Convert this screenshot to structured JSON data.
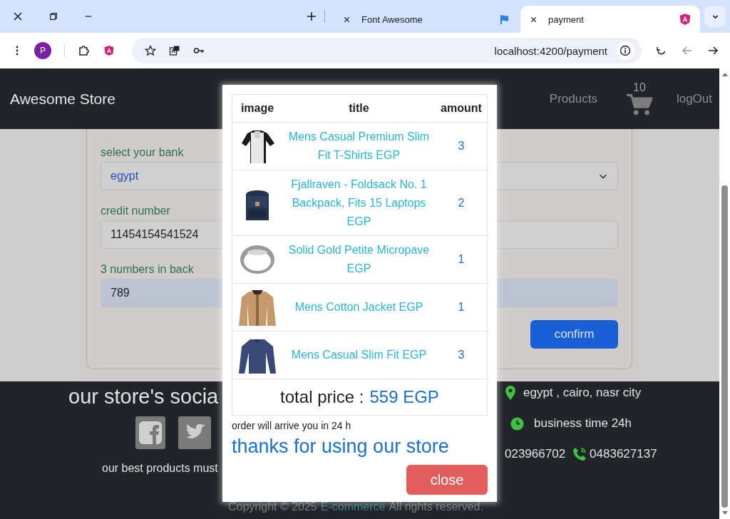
{
  "browser": {
    "tabs": [
      {
        "kind": "page",
        "title": "Font Awesome",
        "selected": false
      },
      {
        "kind": "flag",
        "selected": false
      },
      {
        "kind": "app",
        "title": "payment",
        "selected": true
      }
    ],
    "profile_initial": "P",
    "url": "localhost:4200/payment"
  },
  "navbar": {
    "brand": "Awesome Store",
    "links": [
      "Products"
    ],
    "cart_count": "10",
    "logout": "logOut"
  },
  "form": {
    "fields": [
      {
        "kind": "select",
        "label": "select your bank",
        "value": "egypt",
        "highlighted": false
      },
      {
        "kind": "text",
        "label": "credit number",
        "value": "11454154541524",
        "highlighted": false
      },
      {
        "kind": "text",
        "label": "3 numbers in back",
        "value": "789",
        "highlighted": true
      }
    ],
    "confirm": "confirm"
  },
  "footer": {
    "social_title": "our store's socia",
    "tagline": "our best products must",
    "contacts": [
      {
        "kind": "location",
        "text": "egypt , cairo, nasr city"
      },
      {
        "kind": "time",
        "text": "business time 24h"
      },
      {
        "kind": "phones",
        "text": "023966702",
        "text2": "0483627137"
      }
    ],
    "copyright": "Copyright © 2025",
    "copyright_link": "E-commerce",
    "copyright_tail": "All rights reserved."
  },
  "modal": {
    "columns": [
      "image",
      "title",
      "amount"
    ],
    "rows": [
      {
        "kind": "picture",
        "title": "Mens Casual Premium Slim Fit T-Shirts EGP",
        "amount": "3"
      },
      {
        "kind": "picture",
        "title": "Fjallraven - Foldsack No. 1 Backpack, Fits 15 Laptops EGP",
        "amount": "2"
      },
      {
        "kind": "picture",
        "title": "Solid Gold Petite Micropave EGP",
        "amount": "1"
      },
      {
        "kind": "picture",
        "title": "Mens Cotton Jacket EGP",
        "amount": "1"
      },
      {
        "kind": "picture",
        "title": "Mens Casual Slim Fit EGP",
        "amount": "3"
      }
    ],
    "total_label": "total price :",
    "total_value": "559 EGP",
    "note": "order will arrive you in 24 h",
    "thanks": "thanks for using our store",
    "close": "close"
  }
}
